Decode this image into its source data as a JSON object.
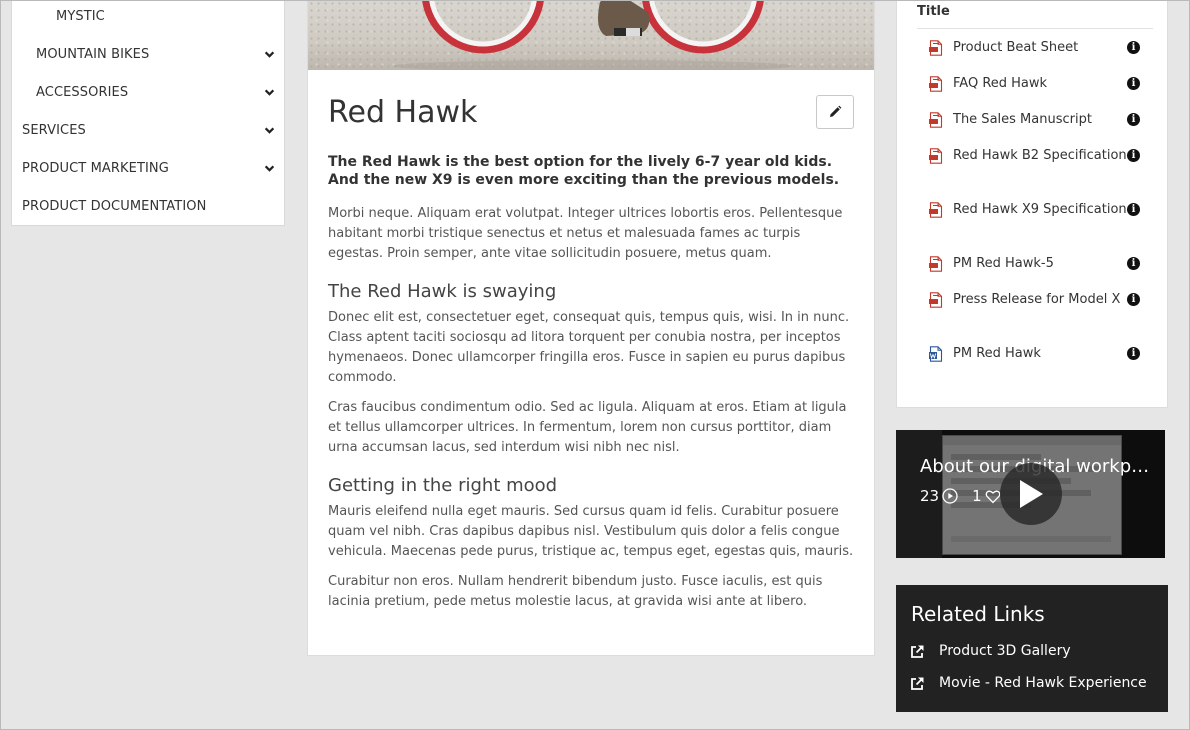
{
  "nav": {
    "items": [
      {
        "label": "MYSTIC",
        "level": 2,
        "expandable": false
      },
      {
        "label": "MOUNTAIN BIKES",
        "level": 1,
        "expandable": true
      },
      {
        "label": "ACCESSORIES",
        "level": 1,
        "expandable": true
      },
      {
        "label": "SERVICES",
        "level": 0,
        "expandable": true
      },
      {
        "label": "PRODUCT MARKETING",
        "level": 0,
        "expandable": true
      },
      {
        "label": "PRODUCT DOCUMENTATION",
        "level": 0,
        "expandable": false
      }
    ]
  },
  "article": {
    "title": "Red Hawk",
    "lead": "The Red Hawk is the best option for the lively 6-7 year old kids. And the new X9 is even more exciting than the previous models.",
    "p1": "Morbi neque. Aliquam erat volutpat. Integer ultrices lobortis eros. Pellentesque habitant morbi tristique senectus et netus et malesuada fames ac turpis egestas. Proin semper, ante vitae sollicitudin posuere, metus quam.",
    "h2a": "The Red Hawk is swaying",
    "p2": "Donec elit est, consectetuer eget, consequat quis, tempus quis, wisi. In in nunc. Class aptent taciti sociosqu ad litora torquent per conubia nostra, per inceptos hymenaeos. Donec ullamcorper fringilla eros. Fusce in sapien eu purus dapibus commodo.",
    "p3": "Cras faucibus condimentum odio. Sed ac ligula. Aliquam at eros. Etiam at ligula et tellus ullamcorper ultrices. In fermentum, lorem non cursus porttitor, diam urna accumsan lacus, sed interdum wisi nibh nec nisl.",
    "h2b": "Getting in the right mood",
    "p4": "Mauris eleifend nulla eget mauris. Sed cursus quam id felis. Curabitur posuere quam vel nibh. Cras dapibus dapibus nisl. Vestibulum quis dolor a felis congue vehicula. Maecenas pede purus, tristique ac, tempus eget, egestas quis, mauris.",
    "p5": "Curabitur non eros. Nullam hendrerit bibendum justo. Fusce iaculis, est quis lacinia pretium, pede metus molestie lacus, at gravida wisi ante at libero."
  },
  "documents": {
    "header": "Title",
    "items": [
      {
        "title": "Product Beat Sheet",
        "type": "pdf-icon"
      },
      {
        "title": "FAQ Red Hawk",
        "type": "pdf-icon"
      },
      {
        "title": "The Sales Manuscript",
        "type": "pdf-icon"
      },
      {
        "title": "Red Hawk B2 Specification",
        "type": "pdf-icon"
      },
      {
        "title": "Red Hawk X9 Specification",
        "type": "pdf-icon"
      },
      {
        "title": "PM Red Hawk-5",
        "type": "pdf-icon"
      },
      {
        "title": "Press Release for Model X",
        "type": "pdf-icon"
      },
      {
        "title": "PM Red Hawk",
        "type": "word-doc-icon"
      }
    ],
    "info_glyph": "i"
  },
  "video": {
    "title": "About our digital workpla...",
    "views": "23",
    "likes": "1"
  },
  "related": {
    "title": "Related Links",
    "links": [
      "Product 3D Gallery",
      "Movie - Red Hawk Experience"
    ]
  },
  "colors": {
    "pdf": "#c0392b",
    "word": "#2b579a",
    "related_bg": "#222222"
  }
}
